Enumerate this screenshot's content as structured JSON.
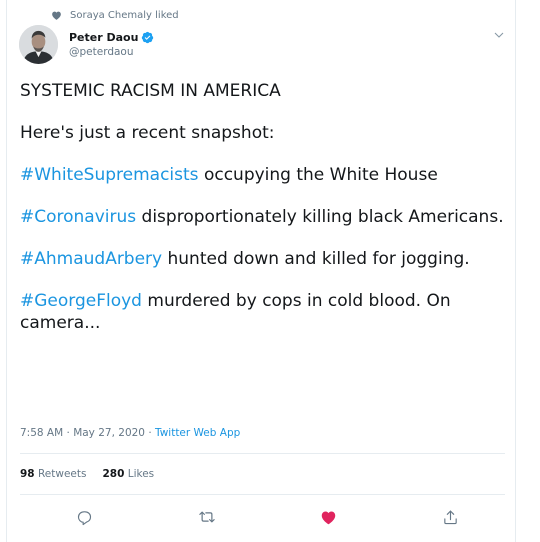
{
  "social_context": {
    "icon": "heart-icon",
    "text": "Soraya Chemaly liked"
  },
  "author": {
    "display_name": "Peter Daou",
    "handle": "@peterdaou",
    "verified": true
  },
  "tweet": {
    "paragraphs": [
      {
        "text": "SYSTEMIC RACISM IN AMERICA"
      },
      {
        "text": "Here's just a recent snapshot:"
      },
      {
        "hashtag": "#WhiteSupremacists",
        "text": " occupying the White House"
      },
      {
        "hashtag": "#Coronavirus",
        "text": " disproportionately killing black Americans."
      },
      {
        "hashtag": "#AhmaudArbery",
        "text": " hunted down and killed for jogging."
      },
      {
        "hashtag": "#GeorgeFloyd",
        "text": " murdered by cops in cold blood. On camera..."
      }
    ]
  },
  "meta": {
    "time": "7:58 AM",
    "separator": " · ",
    "date": "May 27, 2020",
    "app": "Twitter Web App"
  },
  "stats": {
    "retweets_count": "98",
    "retweets_label": "Retweets",
    "likes_count": "280",
    "likes_label": "Likes"
  },
  "actions": {
    "reply_icon": "reply-icon",
    "retweet_icon": "retweet-icon",
    "like_icon": "heart-filled-icon",
    "share_icon": "share-icon"
  },
  "colors": {
    "link": "#1b95e0",
    "like": "#e0245e",
    "muted": "#657786",
    "verified": "#1da1f2"
  }
}
